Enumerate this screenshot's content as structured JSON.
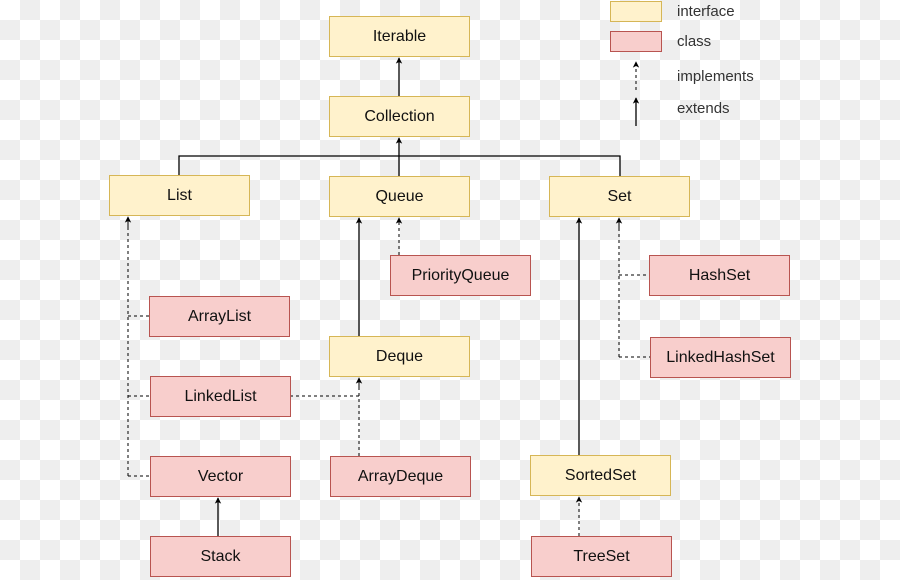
{
  "colors": {
    "interface_fill": "#fff2cc",
    "interface_border": "#d6b656",
    "class_fill": "#f8cecc",
    "class_border": "#b85450",
    "edge": "#000000"
  },
  "legend": {
    "interface_label": "interface",
    "class_label": "class",
    "implements_label": "implements",
    "extends_label": "extends"
  },
  "nodes": {
    "iterable": {
      "label": "Iterable",
      "kind": "interface"
    },
    "collection": {
      "label": "Collection",
      "kind": "interface"
    },
    "list": {
      "label": "List",
      "kind": "interface"
    },
    "queue": {
      "label": "Queue",
      "kind": "interface"
    },
    "set": {
      "label": "Set",
      "kind": "interface"
    },
    "priorityqueue": {
      "label": "PriorityQueue",
      "kind": "class"
    },
    "arraylist": {
      "label": "ArrayList",
      "kind": "class"
    },
    "deque": {
      "label": "Deque",
      "kind": "interface"
    },
    "linkedlist": {
      "label": "LinkedList",
      "kind": "class"
    },
    "vector": {
      "label": "Vector",
      "kind": "class"
    },
    "arraydeque": {
      "label": "ArrayDeque",
      "kind": "class"
    },
    "stack": {
      "label": "Stack",
      "kind": "class"
    },
    "hashset": {
      "label": "HashSet",
      "kind": "class"
    },
    "linkedhashset": {
      "label": "LinkedHashSet",
      "kind": "class"
    },
    "sortedset": {
      "label": "SortedSet",
      "kind": "interface"
    },
    "treeset": {
      "label": "TreeSet",
      "kind": "class"
    }
  },
  "edges": [
    {
      "from": "collection",
      "to": "iterable",
      "type": "extends"
    },
    {
      "from": "list",
      "to": "collection",
      "type": "extends"
    },
    {
      "from": "queue",
      "to": "collection",
      "type": "extends"
    },
    {
      "from": "set",
      "to": "collection",
      "type": "extends"
    },
    {
      "from": "priorityqueue",
      "to": "queue",
      "type": "implements"
    },
    {
      "from": "deque",
      "to": "queue",
      "type": "extends"
    },
    {
      "from": "arraylist",
      "to": "list",
      "type": "implements"
    },
    {
      "from": "linkedlist",
      "to": "list",
      "type": "implements"
    },
    {
      "from": "vector",
      "to": "list",
      "type": "implements"
    },
    {
      "from": "linkedlist",
      "to": "deque",
      "type": "implements"
    },
    {
      "from": "arraydeque",
      "to": "deque",
      "type": "implements"
    },
    {
      "from": "stack",
      "to": "vector",
      "type": "extends"
    },
    {
      "from": "hashset",
      "to": "set",
      "type": "implements"
    },
    {
      "from": "linkedhashset",
      "to": "set",
      "type": "implements"
    },
    {
      "from": "sortedset",
      "to": "set",
      "type": "extends"
    },
    {
      "from": "treeset",
      "to": "sortedset",
      "type": "implements"
    }
  ]
}
